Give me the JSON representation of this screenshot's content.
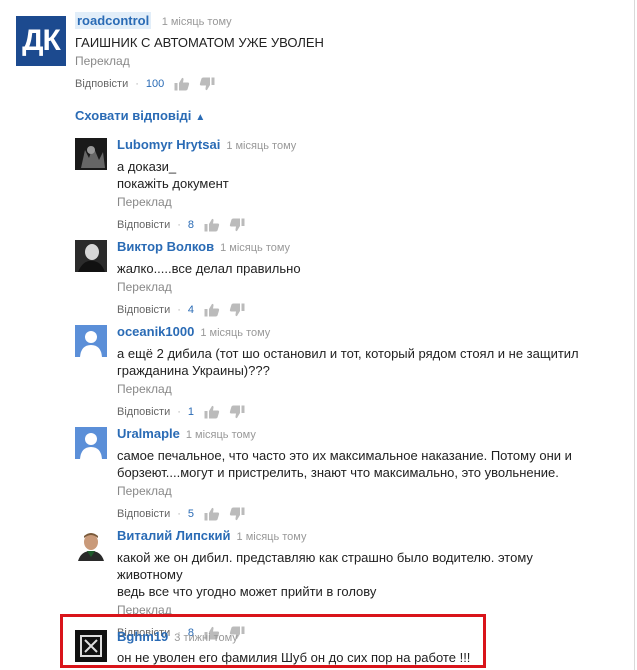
{
  "top_comment": {
    "logo_text": "ДК",
    "author": "roadcontrol",
    "time": "1 місяць тому",
    "text": "ГАИШНИК С АВТОМАТОМ УЖЕ УВОЛЕН",
    "translate": "Переклад",
    "reply_label": "Відповісти",
    "likes": "100"
  },
  "hide_replies_label": "Сховати відповіді",
  "replies": [
    {
      "author": "Lubomyr Hrytsai",
      "time": "1 місяць тому",
      "text": [
        "а докази_",
        "покажіть документ"
      ],
      "translate": "Переклад",
      "reply_label": "Відповісти",
      "likes": "8"
    },
    {
      "author": "Виктор Волков",
      "time": "1 місяць тому",
      "text": [
        "жалко.....все делал правильно"
      ],
      "translate": "Переклад",
      "reply_label": "Відповісти",
      "likes": "4"
    },
    {
      "author": "oceanik1000",
      "time": "1 місяць тому",
      "text": [
        "а ещё 2 дибила (тот шо остановил и тот, который рядом стоял и не защитил",
        "гражданина Украины)???"
      ],
      "translate": "Переклад",
      "reply_label": "Відповісти",
      "likes": "1"
    },
    {
      "author": "Uralmaple",
      "time": "1 місяць тому",
      "text": [
        "самое печальное, что часто это их максимальное наказание. Потому они и",
        "борзеют....могут и пристрелить, знают что максимально, это увольнение."
      ],
      "translate": "Переклад",
      "reply_label": "Відповісти",
      "likes": "5"
    },
    {
      "author": "Виталий Липский",
      "time": "1 місяць тому",
      "text": [
        "какой же он дибил. представляю как страшно было водителю. этому животному",
        "ведь все что угодно может прийти в голову"
      ],
      "translate": "Переклад",
      "reply_label": "Відповісти",
      "likes": "8"
    },
    {
      "author": "Bghm19",
      "time": "3 тижні тому",
      "text": [
        "он не уволен его фамилия Шуб он до сих пор на работе !!!"
      ],
      "translate": "",
      "reply_label": "",
      "likes": ""
    }
  ],
  "colors": {
    "link": "#2a6bb5",
    "logo_bg": "#1c4a8f",
    "highlight": "#d9141a"
  }
}
